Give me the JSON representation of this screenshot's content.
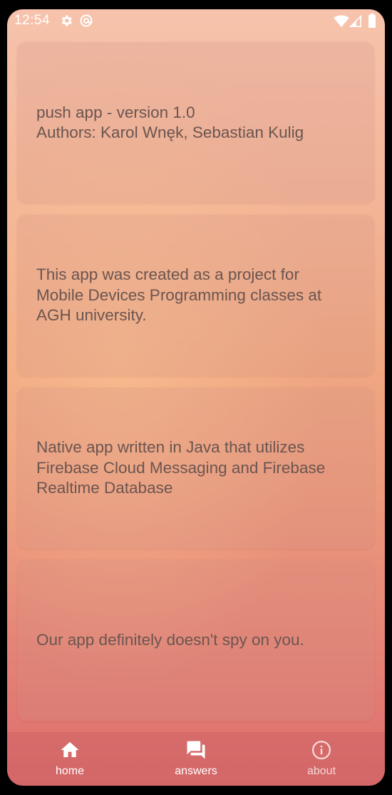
{
  "status_bar": {
    "time": "12:54",
    "icons": [
      "gear-icon",
      "at-sign-icon",
      "wifi-icon",
      "cellular-signal-icon",
      "battery-icon"
    ]
  },
  "cards": [
    {
      "text": "push app - version 1.0\nAuthors: Karol Wnęk, Sebastian Kulig"
    },
    {
      "text": "This app was created as a project for\nMobile Devices Programming classes at\nAGH university."
    },
    {
      "text": "Native app written in Java that utilizes\nFirebase Cloud Messaging and Firebase\nRealtime Database"
    },
    {
      "text": "Our app definitely doesn't spy on you."
    }
  ],
  "bottom_nav": {
    "items": [
      {
        "label": "home",
        "icon": "home-icon",
        "active": true
      },
      {
        "label": "answers",
        "icon": "forum-icon",
        "active": true
      },
      {
        "label": "about",
        "icon": "info-icon",
        "active": false
      }
    ]
  },
  "colors": {
    "gradient_top": "#f7c3ac",
    "gradient_bottom": "#dd6e6d",
    "card_text": "#6b5550",
    "nav_text": "#ffffff"
  }
}
